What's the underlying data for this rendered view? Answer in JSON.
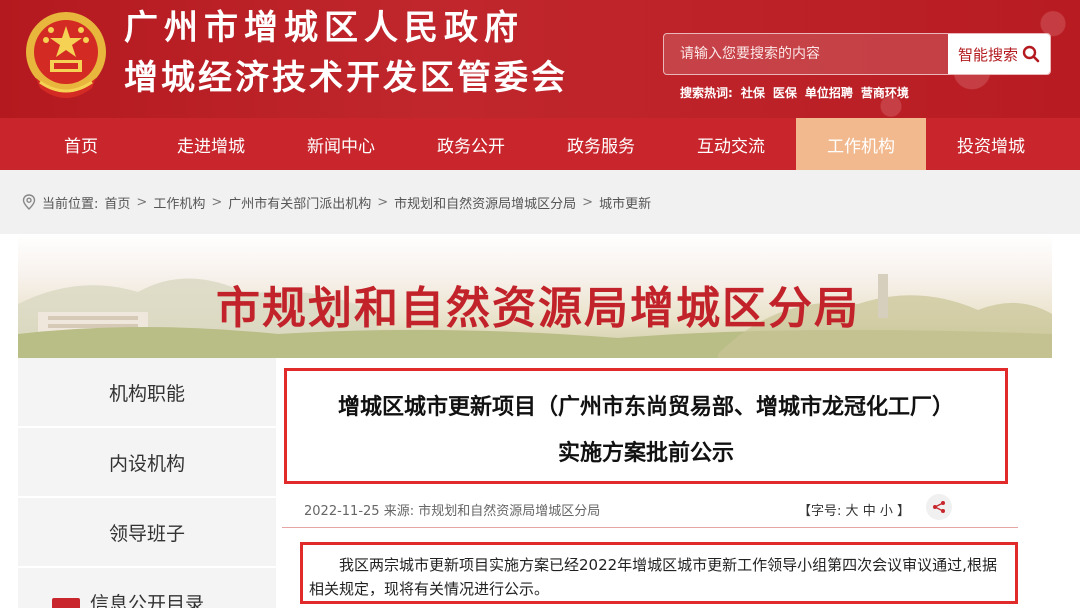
{
  "header": {
    "title_line1": "广州市增城区人民政府",
    "title_line2": "增城经济技术开发区管委会",
    "search": {
      "placeholder": "请输入您要搜索的内容",
      "button_label": "智能搜索"
    },
    "hot_search": {
      "label": "搜索热词:",
      "terms": [
        "社保",
        "医保",
        "单位招聘",
        "营商环境"
      ]
    }
  },
  "nav": {
    "items": [
      "首页",
      "走进增城",
      "新闻中心",
      "政务公开",
      "政务服务",
      "互动交流",
      "工作机构",
      "投资增城"
    ],
    "active": "工作机构"
  },
  "breadcrumb": {
    "prefix": "当前位置:",
    "items": [
      "首页",
      "工作机构",
      "广州市有关部门派出机构",
      "市规划和自然资源局增城区分局",
      "城市更新"
    ]
  },
  "banner": {
    "title": "市规划和自然资源局增城区分局"
  },
  "sidebar": {
    "items": [
      "机构职能",
      "内设机构",
      "领导班子",
      "信息公开目录"
    ]
  },
  "article": {
    "title_line1": "增城区城市更新项目（广州市东尚贸易部、增城市龙冠化工厂）",
    "title_line2": "实施方案批前公示",
    "date": "2022-11-25",
    "source": "来源: 市规划和自然资源局增城区分局",
    "font_size": {
      "label": "【字号:",
      "options": [
        "大",
        "中",
        "小"
      ],
      "end": "】"
    },
    "body": "我区两宗城市更新项目实施方案已经2022年增城区城市更新工作领导小组第四次会议审议通过,根据相关规定，现将有关情况进行公示。"
  },
  "colors": {
    "primary_red": "#c8262c",
    "nav_active": "#f2b98e",
    "highlight_border": "#e12a2a"
  }
}
